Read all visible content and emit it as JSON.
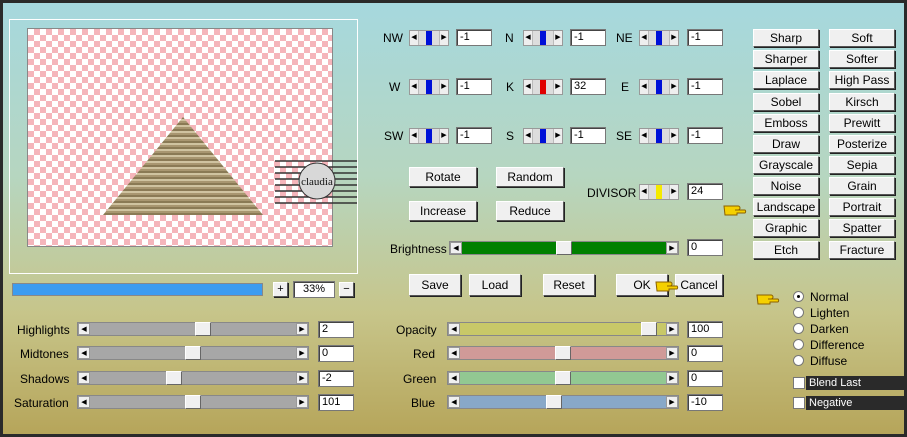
{
  "matrix": {
    "NW": {
      "label": "NW",
      "value": "-1"
    },
    "N": {
      "label": "N",
      "value": "-1"
    },
    "NE": {
      "label": "NE",
      "value": "-1"
    },
    "W": {
      "label": "W",
      "value": "-1"
    },
    "K": {
      "label": "K",
      "value": "32"
    },
    "E": {
      "label": "E",
      "value": "-1"
    },
    "SW": {
      "label": "SW",
      "value": "-1"
    },
    "S": {
      "label": "S",
      "value": "-1"
    },
    "SE": {
      "label": "SE",
      "value": "-1"
    }
  },
  "divisor": {
    "label": "DIVISOR",
    "value": "24"
  },
  "actions": {
    "rotate": "Rotate",
    "random": "Random",
    "increase": "Increase",
    "reduce": "Reduce"
  },
  "brightness": {
    "label": "Brightness",
    "value": "0",
    "level": 0.5
  },
  "footer": {
    "save": "Save",
    "load": "Load",
    "reset": "Reset",
    "ok": "OK",
    "cancel": "Cancel"
  },
  "zoom": {
    "value": "33%",
    "plus": "+",
    "minus": "−",
    "progress": 1.0
  },
  "adjust": [
    {
      "label": "Highlights",
      "value": "2",
      "level": 0.55
    },
    {
      "label": "Midtones",
      "value": "0",
      "level": 0.5
    },
    {
      "label": "Shadows",
      "value": "-2",
      "level": 0.4
    },
    {
      "label": "Saturation",
      "value": "101",
      "level": 0.5
    }
  ],
  "colors": [
    {
      "label": "Opacity",
      "value": "100",
      "level": 0.95,
      "color": "#c8c868"
    },
    {
      "label": "Red",
      "value": "0",
      "level": 0.5,
      "color": "#d09a98"
    },
    {
      "label": "Green",
      "value": "0",
      "level": 0.5,
      "color": "#92c892"
    },
    {
      "label": "Blue",
      "value": "-10",
      "level": 0.45,
      "color": "#88a8c8"
    }
  ],
  "presets": {
    "left": [
      "Sharp",
      "Sharper",
      "Laplace",
      "Sobel",
      "Emboss",
      "Draw",
      "Grayscale",
      "Noise",
      "Landscape",
      "Graphic",
      "Etch"
    ],
    "right": [
      "Soft",
      "Softer",
      "High Pass",
      "Kirsch",
      "Prewitt",
      "Posterize",
      "Sepia",
      "Grain",
      "Portrait",
      "Spatter",
      "Fracture"
    ]
  },
  "blend": {
    "options": [
      "Normal",
      "Lighten",
      "Darken",
      "Difference",
      "Diffuse"
    ],
    "selected": "Normal"
  },
  "checks": {
    "blend_last": "Blend Last",
    "negative": "Negative"
  },
  "watermark": "claudia"
}
